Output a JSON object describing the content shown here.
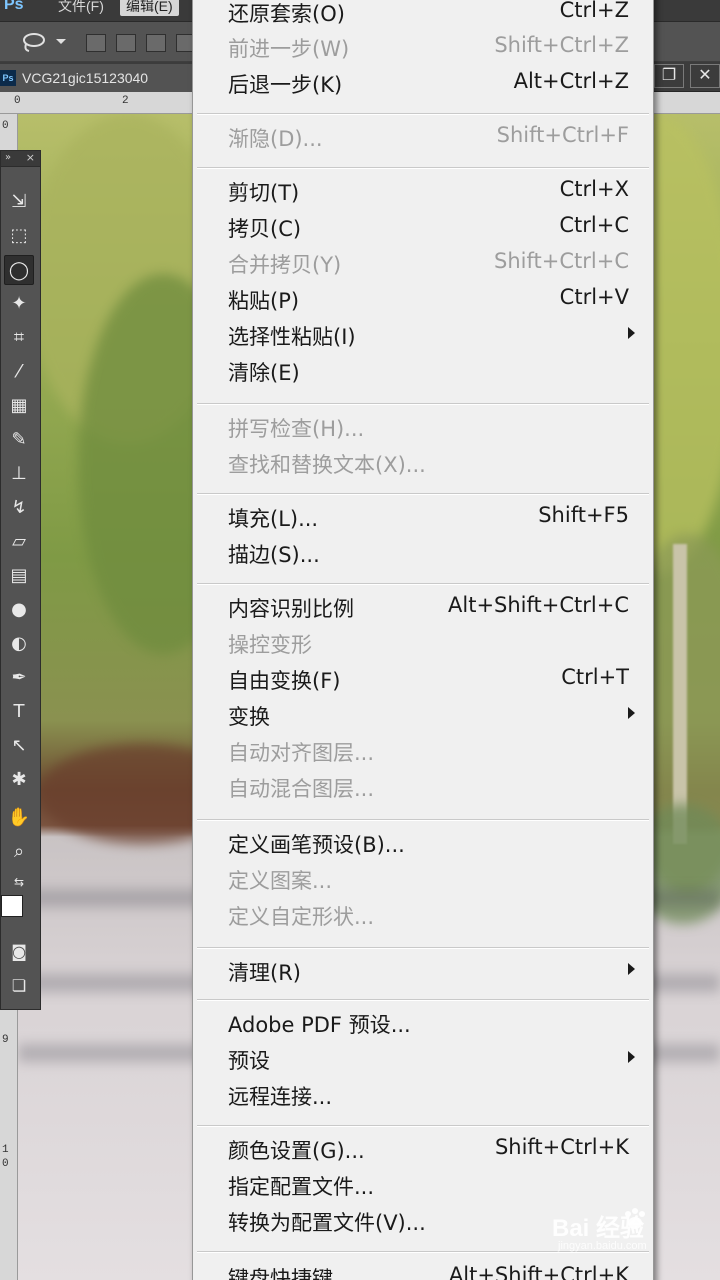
{
  "app": {
    "logo": "Ps"
  },
  "menubar": {
    "file": "文件(F)",
    "edit": "编辑(E)"
  },
  "document": {
    "tab_title": "VCG21gic15123040"
  },
  "window_controls": {
    "restore": "❐",
    "close": "✕"
  },
  "ruler": {
    "top_marks": [
      "0",
      "2"
    ],
    "left_marks": [
      "0",
      "9",
      "1",
      "0"
    ]
  },
  "tools_panel": {
    "collapse": "»",
    "close": "×"
  },
  "colors": {
    "foreground": "#ffffff",
    "background": "#f3d92f",
    "menu_bg": "#f0f0f0",
    "disabled_text": "#9d9d9d"
  },
  "edit_menu": {
    "items": [
      {
        "label": "还原套索(O)",
        "shortcut": "Ctrl+Z",
        "disabled": false
      },
      {
        "label": "前进一步(W)",
        "shortcut": "Shift+Ctrl+Z",
        "disabled": true
      },
      {
        "label": "后退一步(K)",
        "shortcut": "Alt+Ctrl+Z",
        "disabled": false
      },
      {
        "label": "渐隐(D)...",
        "shortcut": "Shift+Ctrl+F",
        "disabled": true
      },
      {
        "label": "剪切(T)",
        "shortcut": "Ctrl+X",
        "disabled": false
      },
      {
        "label": "拷贝(C)",
        "shortcut": "Ctrl+C",
        "disabled": false
      },
      {
        "label": "合并拷贝(Y)",
        "shortcut": "Shift+Ctrl+C",
        "disabled": true
      },
      {
        "label": "粘贴(P)",
        "shortcut": "Ctrl+V",
        "disabled": false
      },
      {
        "label": "选择性粘贴(I)",
        "shortcut": "",
        "disabled": false,
        "submenu": true
      },
      {
        "label": "清除(E)",
        "shortcut": "",
        "disabled": false
      },
      {
        "label": "拼写检查(H)...",
        "shortcut": "",
        "disabled": true
      },
      {
        "label": "查找和替换文本(X)...",
        "shortcut": "",
        "disabled": true
      },
      {
        "label": "填充(L)...",
        "shortcut": "Shift+F5",
        "disabled": false
      },
      {
        "label": "描边(S)...",
        "shortcut": "",
        "disabled": false
      },
      {
        "label": "内容识别比例",
        "shortcut": "Alt+Shift+Ctrl+C",
        "disabled": false
      },
      {
        "label": "操控变形",
        "shortcut": "",
        "disabled": true
      },
      {
        "label": "自由变换(F)",
        "shortcut": "Ctrl+T",
        "disabled": false
      },
      {
        "label": "变换",
        "shortcut": "",
        "disabled": false,
        "submenu": true
      },
      {
        "label": "自动对齐图层...",
        "shortcut": "",
        "disabled": true
      },
      {
        "label": "自动混合图层...",
        "shortcut": "",
        "disabled": true
      },
      {
        "label": "定义画笔预设(B)...",
        "shortcut": "",
        "disabled": false
      },
      {
        "label": "定义图案...",
        "shortcut": "",
        "disabled": true
      },
      {
        "label": "定义自定形状...",
        "shortcut": "",
        "disabled": true
      },
      {
        "label": "清理(R)",
        "shortcut": "",
        "disabled": false,
        "submenu": true
      },
      {
        "label": "Adobe PDF 预设...",
        "shortcut": "",
        "disabled": false
      },
      {
        "label": "预设",
        "shortcut": "",
        "disabled": false,
        "submenu": true
      },
      {
        "label": "远程连接...",
        "shortcut": "",
        "disabled": false
      },
      {
        "label": "颜色设置(G)...",
        "shortcut": "Shift+Ctrl+K",
        "disabled": false
      },
      {
        "label": "指定配置文件...",
        "shortcut": "",
        "disabled": false
      },
      {
        "label": "转换为配置文件(V)...",
        "shortcut": "",
        "disabled": false
      },
      {
        "label": "键盘快捷键...",
        "shortcut": "Alt+Shift+Ctrl+K",
        "disabled": false
      }
    ]
  },
  "watermark": {
    "logo": "Bai  经验",
    "sub": "jingyan.baidu.com"
  }
}
